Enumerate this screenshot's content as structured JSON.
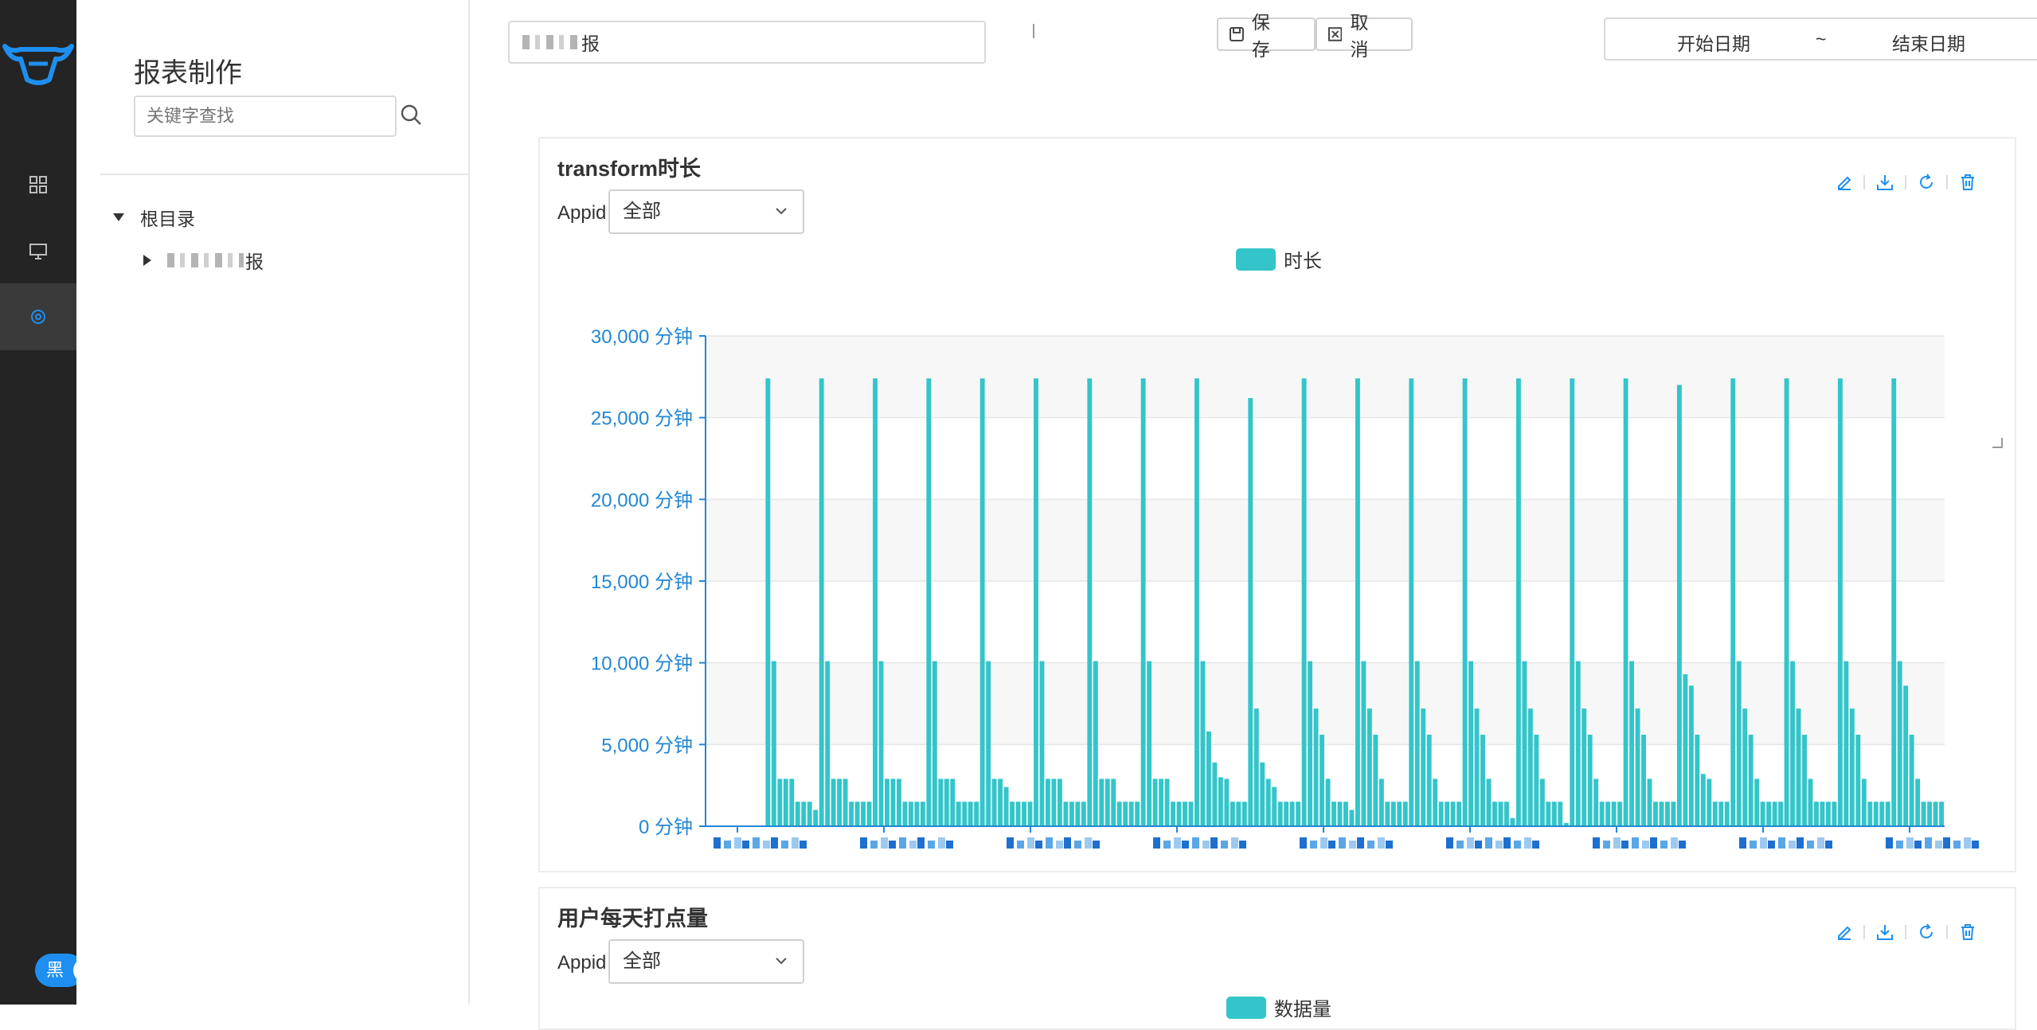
{
  "colors": {
    "rail_bg": "#242424",
    "accent": "#1e8ff0",
    "bar": "#33c5c9",
    "axis": "#2387d4",
    "tool_icon": "#1e8ff0"
  },
  "rail": {
    "logo_icon": "bull-logo-icon",
    "items": [
      {
        "icon": "grid-icon"
      },
      {
        "icon": "monitor-icon"
      },
      {
        "icon": "settings-icon"
      }
    ],
    "theme_label": "黑"
  },
  "panel": {
    "title": "报表制作",
    "search_placeholder": "关键字查找",
    "tree": {
      "root": "根目录",
      "child_suffix": "报"
    }
  },
  "topbar": {
    "report_name_suffix": "报",
    "save_label": "保 存",
    "cancel_label": "取 消",
    "start_date": "开始日期",
    "tilde": "~",
    "end_date": "结束日期"
  },
  "card1": {
    "title": "transform时长",
    "appid_label": "Appid",
    "select_value": "全部",
    "legend": "时长"
  },
  "card2": {
    "title": "用户每天打点量",
    "appid_label": "Appid",
    "select_value": "全部",
    "legend": "数据量"
  },
  "chart_data": {
    "type": "bar",
    "series": [
      {
        "name": "时长",
        "color": "#33c5c9"
      }
    ],
    "ylim": [
      0,
      30000
    ],
    "yticks": [
      "0 分钟",
      "5,000 分钟",
      "10,000 分钟",
      "15,000 分钟",
      "20,000 分钟",
      "25,000 分钟",
      "30,000 分钟"
    ],
    "ytick_values": [
      0,
      5000,
      10000,
      15000,
      20000,
      25000,
      30000
    ],
    "x_labels_obscured": true,
    "grid": true,
    "legend_position": "top-center",
    "values": [
      50,
      0,
      0,
      0,
      0,
      0,
      0,
      0,
      0,
      0,
      27400,
      10100,
      2900,
      2900,
      2900,
      1500,
      1500,
      1500,
      1000,
      27400,
      10100,
      2900,
      2900,
      2900,
      1500,
      1500,
      1500,
      1500,
      27400,
      10100,
      2900,
      2900,
      2900,
      1500,
      1500,
      1500,
      1500,
      27400,
      10100,
      2900,
      2900,
      2900,
      1500,
      1500,
      1500,
      1500,
      27400,
      10100,
      2900,
      2900,
      2400,
      1500,
      1500,
      1500,
      1500,
      27400,
      10100,
      2900,
      2900,
      2900,
      1500,
      1500,
      1500,
      1500,
      27400,
      10100,
      2900,
      2900,
      2900,
      1500,
      1500,
      1500,
      1500,
      27400,
      10100,
      2900,
      2900,
      2900,
      1500,
      1500,
      1500,
      1500,
      27400,
      10100,
      5800,
      3900,
      3000,
      2900,
      1500,
      1500,
      1500,
      26200,
      7200,
      3900,
      2900,
      2400,
      1500,
      1500,
      1500,
      1500,
      27400,
      10100,
      7200,
      5600,
      2900,
      1500,
      1500,
      1500,
      1000,
      27400,
      10100,
      7200,
      5600,
      2900,
      1500,
      1500,
      1500,
      1500,
      27400,
      10100,
      7200,
      5600,
      2900,
      1500,
      1500,
      1500,
      1500,
      27400,
      10100,
      7200,
      5600,
      2900,
      1500,
      1500,
      1500,
      500,
      27400,
      10100,
      7200,
      5600,
      2900,
      1500,
      1500,
      1500,
      200,
      27400,
      10100,
      7200,
      5600,
      2900,
      1500,
      1500,
      1500,
      1500,
      27400,
      10100,
      7200,
      5600,
      2900,
      1500,
      1500,
      1500,
      1500,
      27000,
      9300,
      8600,
      5600,
      3200,
      2900,
      1500,
      1500,
      1500,
      27400,
      10100,
      7200,
      5600,
      2900,
      1500,
      1500,
      1500,
      1500,
      27400,
      10100,
      7200,
      5600,
      2900,
      1500,
      1500,
      1500,
      1500,
      27400,
      10100,
      7200,
      5600,
      2900,
      1500,
      1500,
      1500,
      1500,
      27400,
      10100,
      8600,
      5600,
      2900,
      1500,
      1500,
      1500,
      1500
    ]
  },
  "card_tools": [
    "edit-icon",
    "download-icon",
    "refresh-icon",
    "delete-icon"
  ]
}
